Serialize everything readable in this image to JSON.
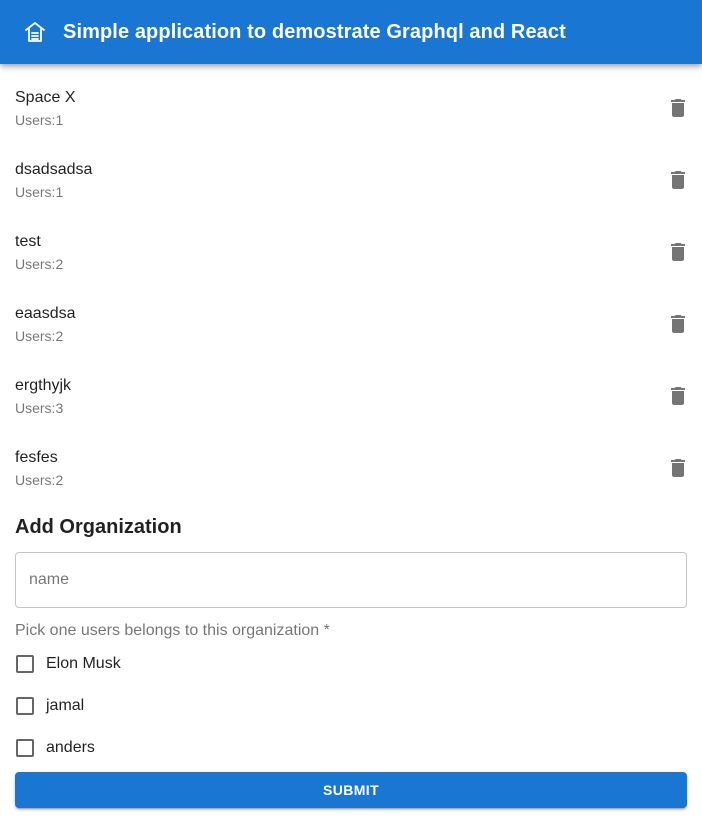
{
  "appbar": {
    "title": "Simple application to demostrate Graphql and React",
    "logo_icon": "house-icon"
  },
  "organizations": [
    {
      "name": "Space X",
      "users": "Users:1"
    },
    {
      "name": "dsadsadsa",
      "users": "Users:1"
    },
    {
      "name": "test",
      "users": "Users:2"
    },
    {
      "name": "eaasdsa",
      "users": "Users:2"
    },
    {
      "name": "ergthyjk",
      "users": "Users:3"
    },
    {
      "name": "fesfes",
      "users": "Users:2"
    }
  ],
  "form": {
    "title": "Add Organization",
    "name_placeholder": "name",
    "name_value": "",
    "pick_label": "Pick one users belongs to this organization *",
    "users": [
      {
        "label": "Elon Musk",
        "checked": false
      },
      {
        "label": "jamal",
        "checked": false
      },
      {
        "label": "anders",
        "checked": false
      }
    ],
    "submit_label": "SUBMIT"
  },
  "colors": {
    "primary": "#1976d2",
    "icon_grey": "#757575"
  }
}
